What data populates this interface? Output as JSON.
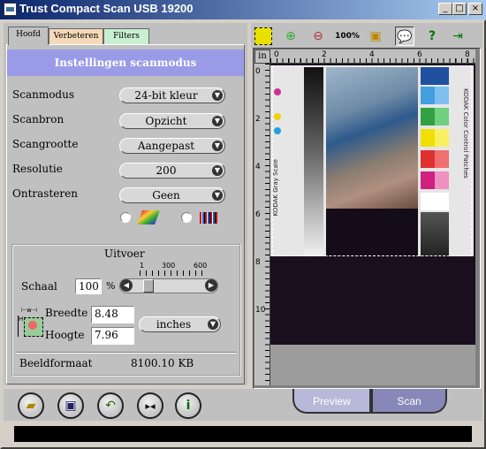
{
  "window": {
    "title": "Trust Compact Scan USB 19200",
    "minimize": "_",
    "maximize": "□",
    "close": "×"
  },
  "tabs": [
    {
      "label": "Hoofd"
    },
    {
      "label": "Verbeteren"
    },
    {
      "label": "Filters"
    }
  ],
  "mode_header": "Instellingen scanmodus",
  "settings": [
    {
      "label": "Scanmodus",
      "value": "24-bit kleur"
    },
    {
      "label": "Scanbron",
      "value": "Opzicht"
    },
    {
      "label": "Scangrootte",
      "value": "Aangepast"
    },
    {
      "label": "Resolutie",
      "value": "200"
    },
    {
      "label": "Ontrasteren",
      "value": "Geen"
    }
  ],
  "output": {
    "title": "Uitvoer",
    "schaal_label": "Schaal",
    "schaal_value": "100",
    "percent": "%",
    "scale_ticks": [
      "1",
      "300",
      "600"
    ],
    "breedte_label": "Breedte",
    "breedte_value": "8.48",
    "hoogte_label": "Hoogte",
    "hoogte_value": "7.96",
    "unit": "inches",
    "beeldformaat_label": "Beeldformaat",
    "beeldformaat_value": "8100.10 KB"
  },
  "toolbar": {
    "zoom_label": "100%"
  },
  "ruler": {
    "unit": "in",
    "h_ticks": [
      "0",
      "2",
      "4",
      "6",
      "8"
    ],
    "v_ticks": [
      "0",
      "2",
      "4",
      "6",
      "8",
      "10"
    ]
  },
  "buttons": {
    "preview": "Preview",
    "scan": "Scan"
  },
  "image_labels": {
    "gray_scale": "KODAK Gray Scale",
    "color_patches": "KODAK Color Control Patches"
  }
}
